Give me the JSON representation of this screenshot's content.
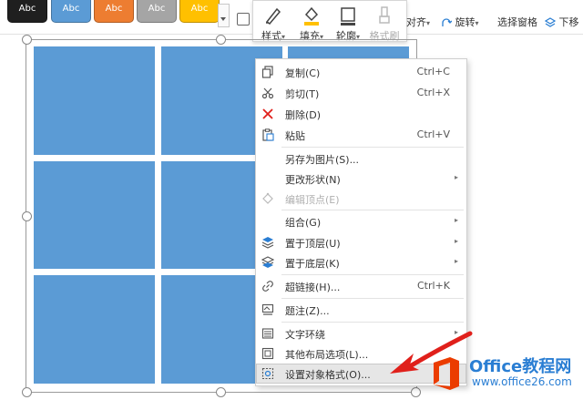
{
  "ribbon": {
    "swatches": [
      {
        "label": "Abc",
        "color": "#1f1f1f"
      },
      {
        "label": "Abc",
        "color": "#5b9bd5"
      },
      {
        "label": "Abc",
        "color": "#ed7d31"
      },
      {
        "label": "Abc",
        "color": "#a5a5a5"
      },
      {
        "label": "Abc",
        "color": "#ffc000"
      }
    ],
    "tools": [
      {
        "label": "样式",
        "icon": "brush-icon",
        "disabled": false
      },
      {
        "label": "填充",
        "icon": "fill-bucket-icon",
        "disabled": false
      },
      {
        "label": "轮廓",
        "icon": "outline-icon",
        "disabled": false
      },
      {
        "label": "格式刷",
        "icon": "format-painter-icon",
        "disabled": true
      }
    ],
    "align_label": "对齐",
    "rotate_label": "旋转",
    "selection_pane_label": "选择窗格",
    "send_back_label": "下移"
  },
  "context_menu": {
    "items": [
      {
        "label": "复制(C)",
        "shortcut": "Ctrl+C",
        "icon": "copy-icon"
      },
      {
        "label": "剪切(T)",
        "shortcut": "Ctrl+X",
        "icon": "scissors-icon"
      },
      {
        "label": "删除(D)",
        "shortcut": "",
        "icon": "delete-x-icon"
      },
      {
        "label": "粘贴",
        "shortcut": "Ctrl+V",
        "icon": "paste-icon"
      },
      {
        "label": "另存为图片(S)...",
        "shortcut": "",
        "icon": ""
      },
      {
        "label": "更改形状(N)",
        "shortcut": "",
        "icon": "",
        "submenu": true
      },
      {
        "label": "编辑顶点(E)",
        "shortcut": "",
        "icon": "edit-points-icon",
        "disabled": true
      },
      {
        "label": "组合(G)",
        "shortcut": "",
        "icon": "",
        "submenu": true
      },
      {
        "label": "置于顶层(U)",
        "shortcut": "",
        "icon": "bring-front-icon",
        "submenu": true
      },
      {
        "label": "置于底层(K)",
        "shortcut": "",
        "icon": "send-back-icon",
        "submenu": true
      },
      {
        "label": "超链接(H)...",
        "shortcut": "Ctrl+K",
        "icon": "hyperlink-icon"
      },
      {
        "label": "题注(Z)...",
        "shortcut": "",
        "icon": "caption-icon"
      },
      {
        "label": "文字环绕",
        "shortcut": "",
        "icon": "text-wrap-icon",
        "submenu": true
      },
      {
        "label": "其他布局选项(L)...",
        "shortcut": "",
        "icon": "layout-options-icon"
      },
      {
        "label": "设置对象格式(O)...",
        "shortcut": "",
        "icon": "format-object-icon",
        "highlighted": true
      }
    ]
  },
  "watermark": {
    "brand": "Office教程网",
    "url": "www.office26.com"
  },
  "colors": {
    "cell_blue": "#5b9bd5",
    "arrow_red": "#e0201b",
    "logo_orange": "#eb3c00",
    "logo_blue": "#2a7ed3"
  }
}
